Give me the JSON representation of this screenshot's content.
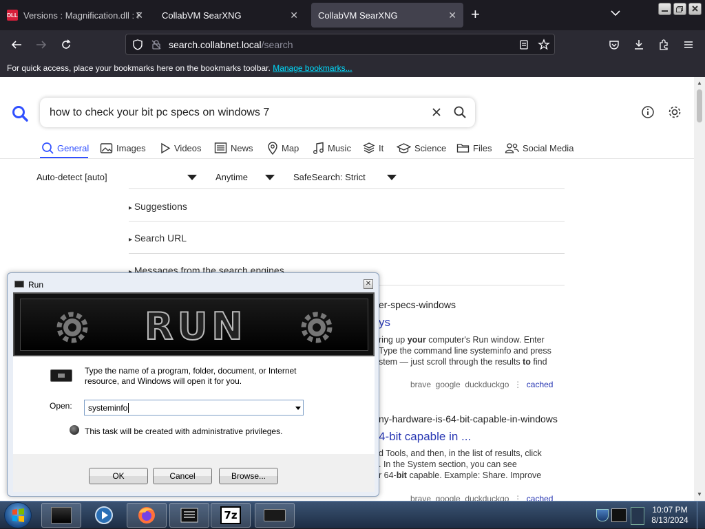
{
  "browser": {
    "tabs": [
      {
        "title": "Versions : Magnification.dll : Fil",
        "favicon": "DLL",
        "active": false
      },
      {
        "title": "CollabVM SearXNG",
        "active": false
      },
      {
        "title": "CollabVM SearXNG",
        "active": true
      }
    ],
    "url_host": "search.collabnet.local",
    "url_path": "/search",
    "bookmarks_text": "For quick access, place your bookmarks here on the bookmarks toolbar.",
    "bookmarks_link": "Manage bookmarks..."
  },
  "searx": {
    "query": "how to check your bit pc specs on windows 7",
    "categories": [
      {
        "label": "General",
        "icon": "search-icon",
        "active": true
      },
      {
        "label": "Images",
        "icon": "image-icon"
      },
      {
        "label": "Videos",
        "icon": "play-icon"
      },
      {
        "label": "News",
        "icon": "newspaper-icon"
      },
      {
        "label": "Map",
        "icon": "map-pin-icon"
      },
      {
        "label": "Music",
        "icon": "music-icon"
      },
      {
        "label": "It",
        "icon": "layers-icon"
      },
      {
        "label": "Science",
        "icon": "school-icon"
      },
      {
        "label": "Files",
        "icon": "files-icon"
      },
      {
        "label": "Social Media",
        "icon": "people-icon"
      }
    ],
    "filters": {
      "language": "Auto-detect [auto]",
      "time": "Anytime",
      "safesearch": "SafeSearch: Strict"
    },
    "sections": [
      "Suggestions",
      "Search URL",
      "Messages from the search engines"
    ],
    "results": [
      {
        "url_tail": "er-specs-windows",
        "title_tail": "ys",
        "snippet": [
          {
            "t": "ring up "
          },
          {
            "t": "your",
            "b": true
          },
          {
            "t": " computer's Run window. Enter"
          }
        ],
        "snippet_line2": "Type the command line systeminfo and press",
        "snippet_line3_pre": "stem — just scroll through the results ",
        "snippet_line3_bold": "to",
        "snippet_line3_post": " find",
        "engines": "brave  google  duckduckgo",
        "cached": "cached"
      },
      {
        "url_tail": "ny-hardware-is-64-bit-capable-in-windows",
        "title_tail": "4-bit capable in ...",
        "snippet_line1": "d Tools, and then, in the list of results, click",
        "snippet_line2": ". In the System section, you can see",
        "snippet_line3_pre": "r 64-",
        "snippet_line3_bold": "bit",
        "snippet_line3_post": " capable. Example: Share. Improve",
        "engines": "brave  google  duckduckgo",
        "cached": "cached"
      }
    ]
  },
  "run_dialog": {
    "title": "Run",
    "banner": "RUN",
    "description": "Type the name of a program, folder, document, or Internet resource, and Windows will open it for you.",
    "open_label": "Open:",
    "open_value": "systeminfo",
    "admin_note": "This task will be created with administrative privileges.",
    "ok": "OK",
    "cancel": "Cancel",
    "browse": "Browse..."
  },
  "taskbar": {
    "time": "10:07 PM",
    "date": "8/13/2024"
  },
  "colors": {
    "accent": "#3050ff",
    "link": "#2837b3"
  }
}
